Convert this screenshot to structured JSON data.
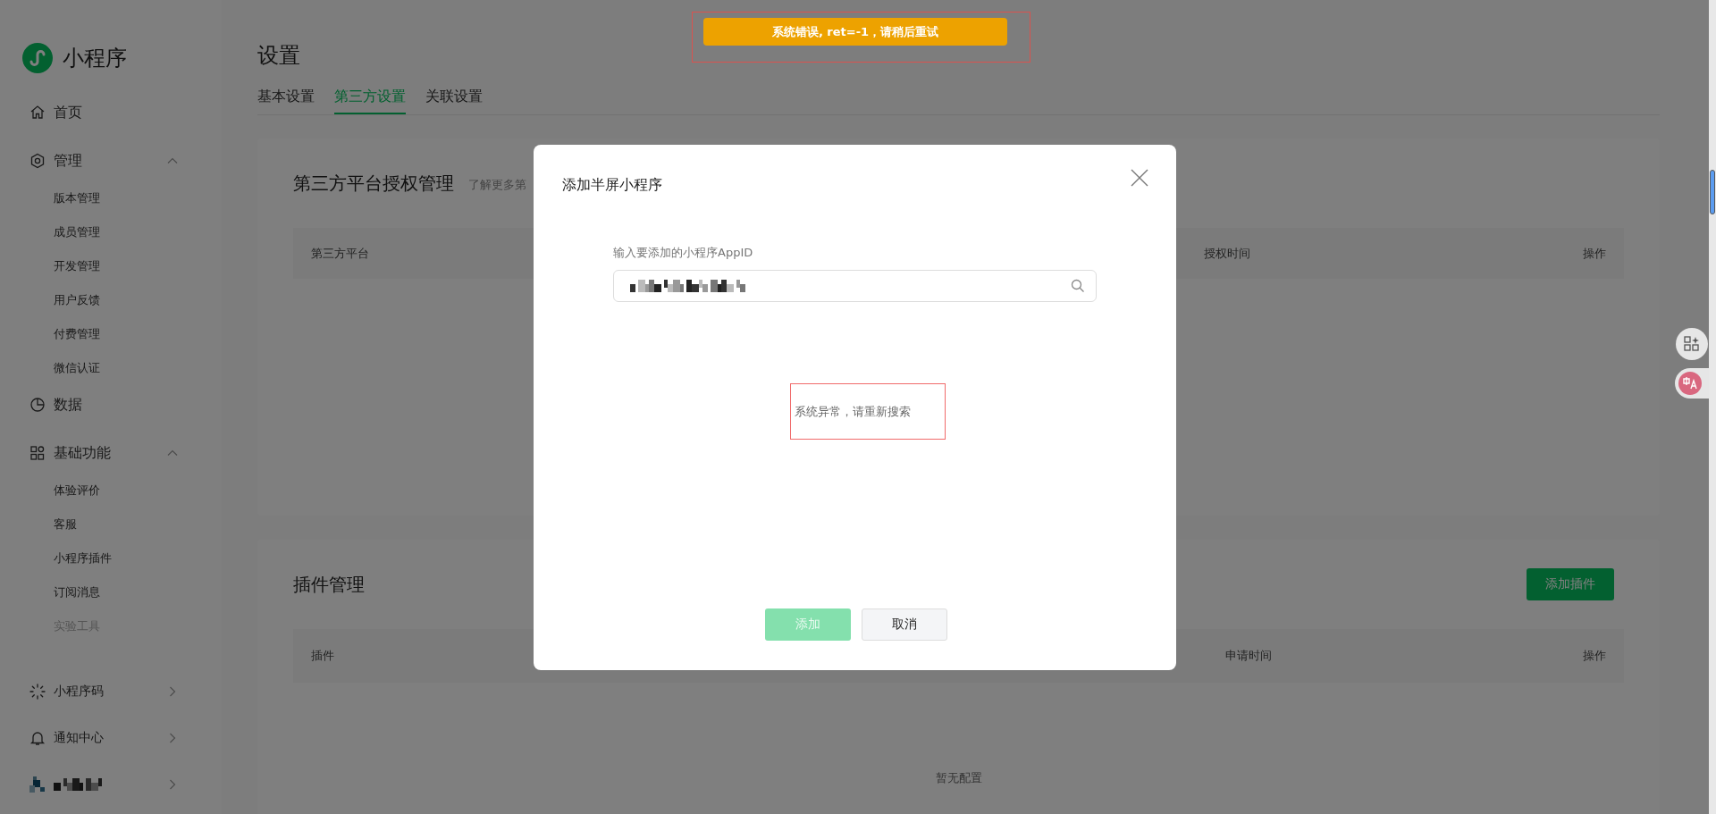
{
  "sidebar": {
    "logo_text": "小程序",
    "items": [
      {
        "label": "首页"
      },
      {
        "label": "管理",
        "expanded": true,
        "children": [
          {
            "label": "版本管理",
            "disabled": false
          },
          {
            "label": "成员管理",
            "disabled": false
          },
          {
            "label": "开发管理",
            "disabled": false
          },
          {
            "label": "用户反馈",
            "disabled": false
          },
          {
            "label": "付费管理",
            "disabled": false
          },
          {
            "label": "微信认证",
            "disabled": false
          }
        ]
      },
      {
        "label": "数据"
      },
      {
        "label": "基础功能",
        "expanded": true,
        "children": [
          {
            "label": "体验评价",
            "disabled": false
          },
          {
            "label": "客服",
            "disabled": false
          },
          {
            "label": "小程序插件",
            "disabled": false
          },
          {
            "label": "订阅消息",
            "disabled": false
          },
          {
            "label": "实验工具",
            "disabled": true
          }
        ]
      }
    ],
    "bottom_items": [
      {
        "kind": "link",
        "label": "小程序码"
      },
      {
        "kind": "link",
        "label": "通知中心"
      },
      {
        "kind": "account",
        "redacted": true
      }
    ]
  },
  "page": {
    "title": "设置",
    "tabs": [
      {
        "label": "基本设置",
        "selected": false
      },
      {
        "label": "第三方设置",
        "selected": true
      },
      {
        "label": "关联设置",
        "selected": false
      }
    ]
  },
  "sections": [
    {
      "title": "第三方平台授权管理",
      "link": "了解更多第",
      "columns": [
        "第三方平台",
        "授权时间",
        "操作"
      ]
    },
    {
      "title": "插件管理",
      "button": "添加插件",
      "columns": [
        "插件",
        "申请时间",
        "操作"
      ],
      "empty_text": "暂无配置"
    }
  ],
  "dialog": {
    "title": "添加半屏小程序",
    "field": {
      "label": "输入要添加的小程序AppID",
      "redacted": true
    },
    "message": "系统异常，请重新搜索",
    "buttons": [
      {
        "label": "添加",
        "kind": "primary",
        "disabled": true
      },
      {
        "label": "取消",
        "kind": "default",
        "disabled": false
      }
    ]
  },
  "toast": {
    "text": "系统错误, ret=-1，请稍后重试"
  }
}
